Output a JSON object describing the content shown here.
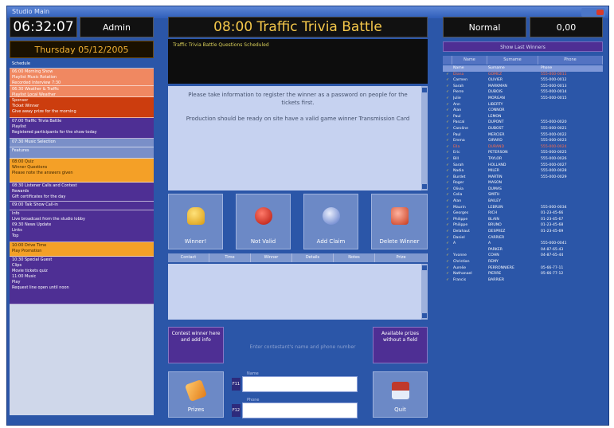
{
  "window": {
    "title": "Studio Main"
  },
  "clock": "06:32:07",
  "user": "Admin",
  "date": "Thursday 05/12/2005",
  "show": {
    "title": "08:00  Traffic Trivia Battle"
  },
  "marquee": "Traffic Trivia Battle Questions Scheduled",
  "notes": [
    "Please take information to register the winner as a password on people for the tickets first.",
    "Production should be ready on site have a valid game winner Transmission Card"
  ],
  "actions": [
    {
      "label": "Winner!"
    },
    {
      "label": "Not Valid"
    },
    {
      "label": "Add Claim"
    },
    {
      "label": "Delete Winner"
    }
  ],
  "tabs": [
    "Contact",
    "Time",
    "Winner",
    "Details",
    "Notes",
    "Prize"
  ],
  "left_buttons": {
    "top": "Contest winner here and add info",
    "bottom": "Prizes"
  },
  "right_buttons": {
    "top": "Available prizes without a field",
    "bottom": "Quit"
  },
  "hint": "Enter contestant's name and phone number",
  "inputs": [
    {
      "key": "F11",
      "label": "Name",
      "value": "",
      "placeholder": ""
    },
    {
      "key": "F12",
      "label": "Phone",
      "value": "",
      "placeholder": ""
    }
  ],
  "mode": "Normal",
  "amount": "0,00",
  "right_panel": {
    "button": "Show Last Winners",
    "columns": [
      "",
      "Name",
      "Surname",
      "Phone"
    ],
    "rows": [
      {
        "flag": "",
        "name": "Name",
        "surname": "Surname",
        "phone": "Phone",
        "style": "sel"
      },
      {
        "flag": "✓",
        "name": "Diana",
        "surname": "GOMEZ",
        "phone": "555-000-0011",
        "style": "red"
      },
      {
        "flag": "✓",
        "name": "Carmen",
        "surname": "OLIVIER",
        "phone": "555-000-0012",
        "style": ""
      },
      {
        "flag": "✓",
        "name": "Sarah",
        "surname": "MARKMAN",
        "phone": "555-000-0013",
        "style": ""
      },
      {
        "flag": "✓",
        "name": "Pierre",
        "surname": "DUBOIS",
        "phone": "555-000-0014",
        "style": ""
      },
      {
        "flag": "✓",
        "name": "Julie",
        "surname": "MORGAN",
        "phone": "555-000-0015",
        "style": ""
      },
      {
        "flag": "✓",
        "name": "Ann",
        "surname": "LIBERTY",
        "phone": "",
        "style": ""
      },
      {
        "flag": "✓",
        "name": "Alan",
        "surname": "CONNOR",
        "phone": "",
        "style": ""
      },
      {
        "flag": "✓",
        "name": "Paul",
        "surname": "LEMON",
        "phone": "",
        "style": ""
      },
      {
        "flag": "✓",
        "name": "Pascal",
        "surname": "DUPONT",
        "phone": "555-000-0020",
        "style": ""
      },
      {
        "flag": "✓",
        "name": "Caroline",
        "surname": "DUBOST",
        "phone": "555-000-0021",
        "style": ""
      },
      {
        "flag": "✓",
        "name": "Paul",
        "surname": "MERCIER",
        "phone": "555-000-0022",
        "style": ""
      },
      {
        "flag": "✓",
        "name": "Emma",
        "surname": "GIRARD",
        "phone": "555-000-0023",
        "style": ""
      },
      {
        "flag": "✓",
        "name": "Ella",
        "surname": "DURAND",
        "phone": "555-000-0024",
        "style": "red"
      },
      {
        "flag": "✓",
        "name": "Eric",
        "surname": "PETERSON",
        "phone": "555-000-0025",
        "style": ""
      },
      {
        "flag": "✓",
        "name": "Bill",
        "surname": "TAYLOR",
        "phone": "555-000-0026",
        "style": ""
      },
      {
        "flag": "✓",
        "name": "Sarah",
        "surname": "HOLLAND",
        "phone": "555-000-0027",
        "style": ""
      },
      {
        "flag": "✓",
        "name": "Nadia",
        "surname": "MILER",
        "phone": "555-000-0028",
        "style": ""
      },
      {
        "flag": "✓",
        "name": "Burdet",
        "surname": "MARTIN",
        "phone": "555-000-0029",
        "style": ""
      },
      {
        "flag": "✓",
        "name": "Roger",
        "surname": "MASON",
        "phone": "",
        "style": ""
      },
      {
        "flag": "✓",
        "name": "Olivia",
        "surname": "DUMAS",
        "phone": "",
        "style": ""
      },
      {
        "flag": "✓",
        "name": "Celia",
        "surname": "SMITH",
        "phone": "",
        "style": ""
      },
      {
        "flag": "✓",
        "name": "Alan",
        "surname": "BAILEY",
        "phone": "",
        "style": ""
      },
      {
        "flag": "✓",
        "name": "Maurin",
        "surname": "LEBRUN",
        "phone": "555-000-0034",
        "style": ""
      },
      {
        "flag": "✓",
        "name": "Georges",
        "surname": "RICH",
        "phone": "01-23-45-66",
        "style": ""
      },
      {
        "flag": "✓",
        "name": "Philippe",
        "surname": "BLAIN",
        "phone": "01-23-45-67",
        "style": ""
      },
      {
        "flag": "✓",
        "name": "Philippe",
        "surname": "BRUNO",
        "phone": "01-23-45-68",
        "style": ""
      },
      {
        "flag": "✓",
        "name": "Delahaut",
        "surname": "DESPREZ",
        "phone": "01-23-45-69",
        "style": ""
      },
      {
        "flag": "✓",
        "name": "Daniel",
        "surname": "CARRIER",
        "phone": "",
        "style": ""
      },
      {
        "flag": "✓",
        "name": "A",
        "surname": "A",
        "phone": "555-000-0041",
        "style": ""
      },
      {
        "flag": "✓",
        "name": "",
        "surname": "PARKER",
        "phone": "04-87-65-43",
        "style": ""
      },
      {
        "flag": "✓",
        "name": "Yvonne",
        "surname": "COHN",
        "phone": "04-87-65-44",
        "style": ""
      },
      {
        "flag": "✓",
        "name": "Christian",
        "surname": "REMY",
        "phone": "",
        "style": ""
      },
      {
        "flag": "✓",
        "name": "Aurelie",
        "surname": "PERRONNIERE",
        "phone": "05-66-77-11",
        "style": ""
      },
      {
        "flag": "✓",
        "name": "Nathanael",
        "surname": "PIERRE",
        "phone": "05-66-77-12",
        "style": ""
      },
      {
        "flag": "✓",
        "name": "Francis",
        "surname": "BARRIER",
        "phone": "",
        "style": ""
      }
    ]
  },
  "left_events": [
    {
      "style": "hdr",
      "lines": [
        "Schedule"
      ]
    },
    {
      "style": "salmon",
      "lines": [
        "06:00 Morning Show",
        "   Playlist        Music Rotation",
        "   Recorded Interview 7:30"
      ]
    },
    {
      "style": "salmon",
      "lines": [
        "06:30 Weather & Traffic",
        "   Playlist        Local Weather"
      ]
    },
    {
      "style": "red",
      "lines": [
        "Sponsor",
        "   Ticket          Winner",
        "   Give away prize for the morning"
      ]
    },
    {
      "style": "blue",
      "lines": [
        "07:00 Traffic Trivia Battle",
        "   Playlist",
        "   Registered participants for the show today"
      ]
    },
    {
      "style": "light",
      "lines": [
        "07:30 Music Selection"
      ]
    },
    {
      "style": "light",
      "lines": [
        "   Features"
      ]
    },
    {
      "style": "orange",
      "lines": [
        "08:00 Quiz",
        "   Winner          Questions",
        "   Please note the answers given"
      ]
    },
    {
      "style": "blue",
      "lines": [
        "08:30 Listener Calls and Contest",
        "   Rewards",
        "   Gift certificates for the day"
      ]
    },
    {
      "style": "blue",
      "lines": [
        "09:00 Talk Show        Call-in"
      ]
    },
    {
      "style": "blue",
      "lines": [
        "   Info",
        "   Live broadcast from the studio lobby",
        "09:30 News Update",
        "   Links",
        "   Top"
      ]
    },
    {
      "style": "orange",
      "lines": [
        "10:00 Drive Time",
        "   Play            Promotion"
      ]
    },
    {
      "style": "blue",
      "lines": [
        "10:30 Special Guest",
        "   Clips",
        "   Movie tickets quiz",
        "11:00 Music",
        "   Play",
        "   Request line open until noon"
      ]
    }
  ]
}
